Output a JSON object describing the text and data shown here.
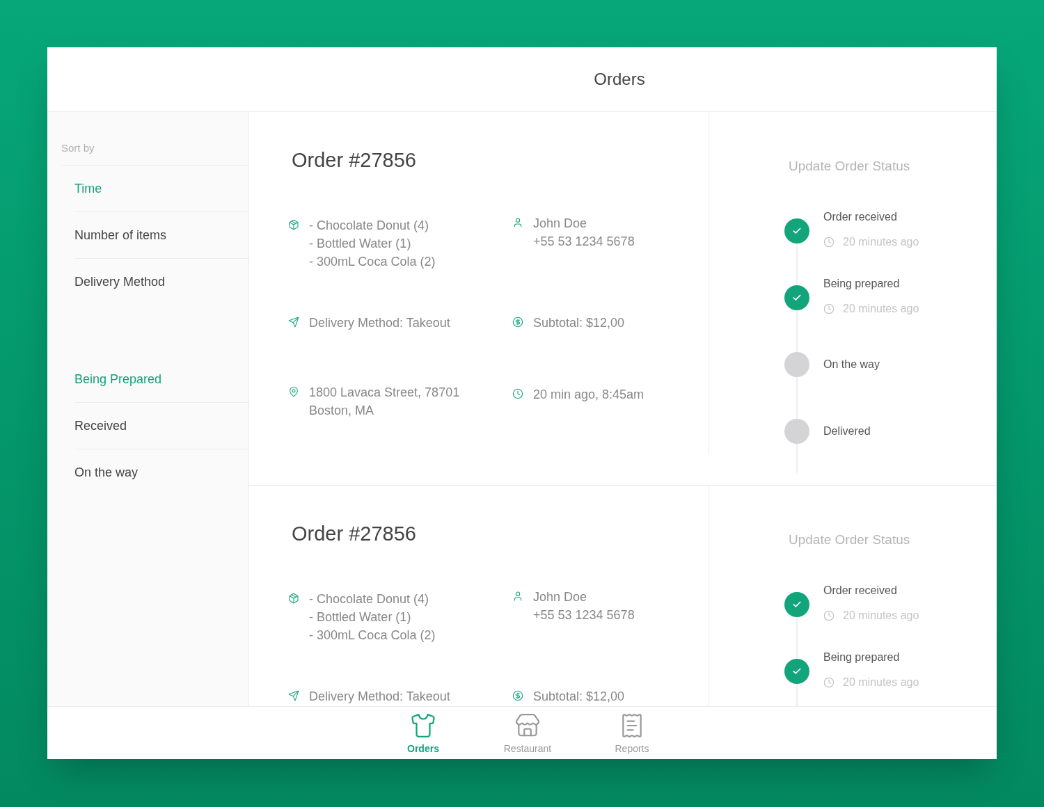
{
  "header": {
    "title": "Orders"
  },
  "sidebar": {
    "groups": [
      {
        "heading": "Sort by",
        "items": [
          {
            "label": "Time",
            "selected": true
          },
          {
            "label": "Number of items",
            "selected": false
          },
          {
            "label": "Delivery Method",
            "selected": false
          }
        ]
      },
      {
        "items": [
          {
            "label": "Being Prepared",
            "selected": true
          },
          {
            "label": "Received",
            "selected": false
          },
          {
            "label": "On the way",
            "selected": false
          }
        ]
      }
    ]
  },
  "orders": [
    {
      "title": "Order #27856",
      "items": [
        "- Chocolate Donut (4)",
        "- Bottled Water (1)",
        "- 300mL Coca Cola (2)"
      ],
      "customer": {
        "name": "John Doe",
        "phone": "+55 53 1234 5678"
      },
      "delivery": "Delivery Method: Takeout",
      "subtotal": "Subtotal: $12,00",
      "address": [
        "1800 Lavaca Street, 78701",
        "Boston, MA"
      ],
      "time": "20 min ago, 8:45am",
      "status": {
        "title": "Update Order Status",
        "steps": [
          {
            "label": "Order received",
            "done": true,
            "time": "20 minutes ago"
          },
          {
            "label": "Being prepared",
            "done": true,
            "time": "20 minutes ago"
          },
          {
            "label": "On the way",
            "done": false
          },
          {
            "label": "Delivered",
            "done": false
          }
        ]
      }
    },
    {
      "title": "Order #27856",
      "items": [
        "- Chocolate Donut (4)",
        "- Bottled Water (1)",
        "- 300mL Coca Cola (2)"
      ],
      "customer": {
        "name": "John Doe",
        "phone": "+55 53 1234 5678"
      },
      "delivery": "Delivery Method: Takeout",
      "subtotal": "Subtotal: $12,00",
      "status": {
        "title": "Update Order Status",
        "steps": [
          {
            "label": "Order received",
            "done": true,
            "time": "20 minutes ago"
          },
          {
            "label": "Being prepared",
            "done": true,
            "time": "20 minutes ago"
          }
        ]
      }
    }
  ],
  "nav": [
    {
      "kind": "orders",
      "label": "Orders",
      "selected": true
    },
    {
      "kind": "restaurant",
      "label": "Restaurant",
      "selected": false
    },
    {
      "kind": "reports",
      "label": "Reports",
      "selected": false
    }
  ]
}
